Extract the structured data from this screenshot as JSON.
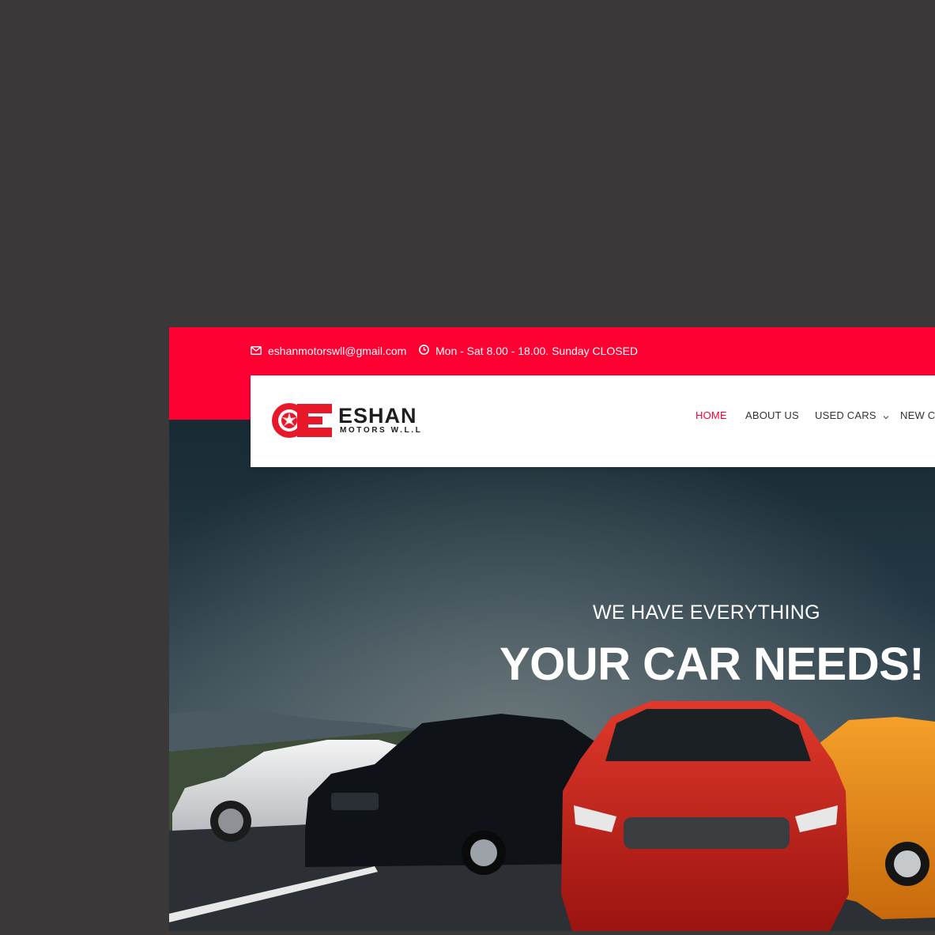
{
  "topbar": {
    "email": "eshanmotorswll@gmail.com",
    "hours": "Mon - Sat 8.00 - 18.00. Sunday CLOSED",
    "email_icon": "envelope-icon",
    "hours_icon": "clock-icon"
  },
  "brand": {
    "name": "ESHAN",
    "tagline": "MOTORS W.L.L"
  },
  "nav": {
    "items": [
      {
        "label": "HOME"
      },
      {
        "label": "ABOUT US"
      },
      {
        "label": "USED CARS"
      },
      {
        "label": "NEW CA"
      }
    ]
  },
  "hero": {
    "subtitle": "WE HAVE EVERYTHING",
    "title": "YOUR CAR NEEDS!"
  },
  "colors": {
    "accent": "#ff0033",
    "page_background": "#3a3839",
    "nav_text": "#333333",
    "hero_text": "#ffffff"
  }
}
